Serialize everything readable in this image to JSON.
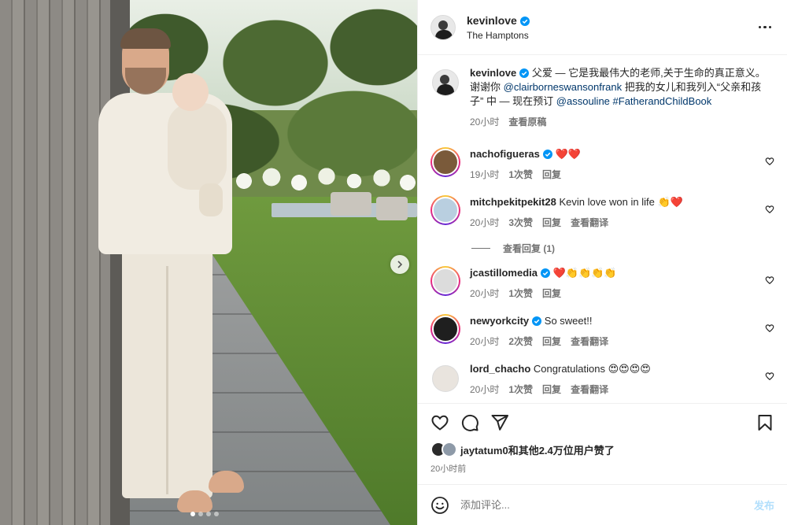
{
  "header": {
    "username": "kevinlove",
    "location": "The Hamptons"
  },
  "caption": {
    "username": "kevinlove",
    "text_1": " 父爱 — 它是我最伟大的老师,关于生命的真正意义。 谢谢你 ",
    "mention_1": "@clairborneswansonfrank",
    "text_2": " 把我的女儿和我列入“父亲和孩子” 中 — 现在预订 ",
    "mention_2": "@assouline",
    "hashtag": "#FatherandChildBook",
    "time": "20小时",
    "see_translation": "查看原稿"
  },
  "comments": [
    {
      "username": "nachofigueras",
      "verified": true,
      "text": "❤️❤️",
      "time": "19小时",
      "likes": "1次赞",
      "reply": "回复",
      "translate": ""
    },
    {
      "username": "mitchpekitpekit28",
      "verified": false,
      "text": "Kevin love won in life 👏❤️",
      "time": "20小时",
      "likes": "3次赞",
      "reply": "回复",
      "translate": "查看翻译"
    },
    {
      "username": "jcastillomedia",
      "verified": true,
      "text": "❤️👏👏👏👏",
      "time": "20小时",
      "likes": "1次赞",
      "reply": "回复",
      "translate": ""
    },
    {
      "username": "newyorkcity",
      "verified": true,
      "text": "So sweet!!",
      "time": "20小时",
      "likes": "2次赞",
      "reply": "回复",
      "translate": "查看翻译"
    },
    {
      "username": "lord_chacho",
      "verified": false,
      "text": "Congratulations 😍😍😍😍",
      "time": "20小时",
      "likes": "1次赞",
      "reply": "回复",
      "translate": "查看翻译"
    }
  ],
  "view_replies": "查看回复 (1)",
  "likes": {
    "text": "jaytatum0和其他2.4万位用户赞了"
  },
  "post_time": "20小时前",
  "add_comment": {
    "placeholder": "添加评论...",
    "post_label": "发布"
  },
  "carousel": {
    "total": 4,
    "active": 1
  },
  "colors": {
    "link": "#00376b",
    "verified": "#0095f6",
    "meta": "#737373",
    "post_button": "#b2dffc"
  }
}
